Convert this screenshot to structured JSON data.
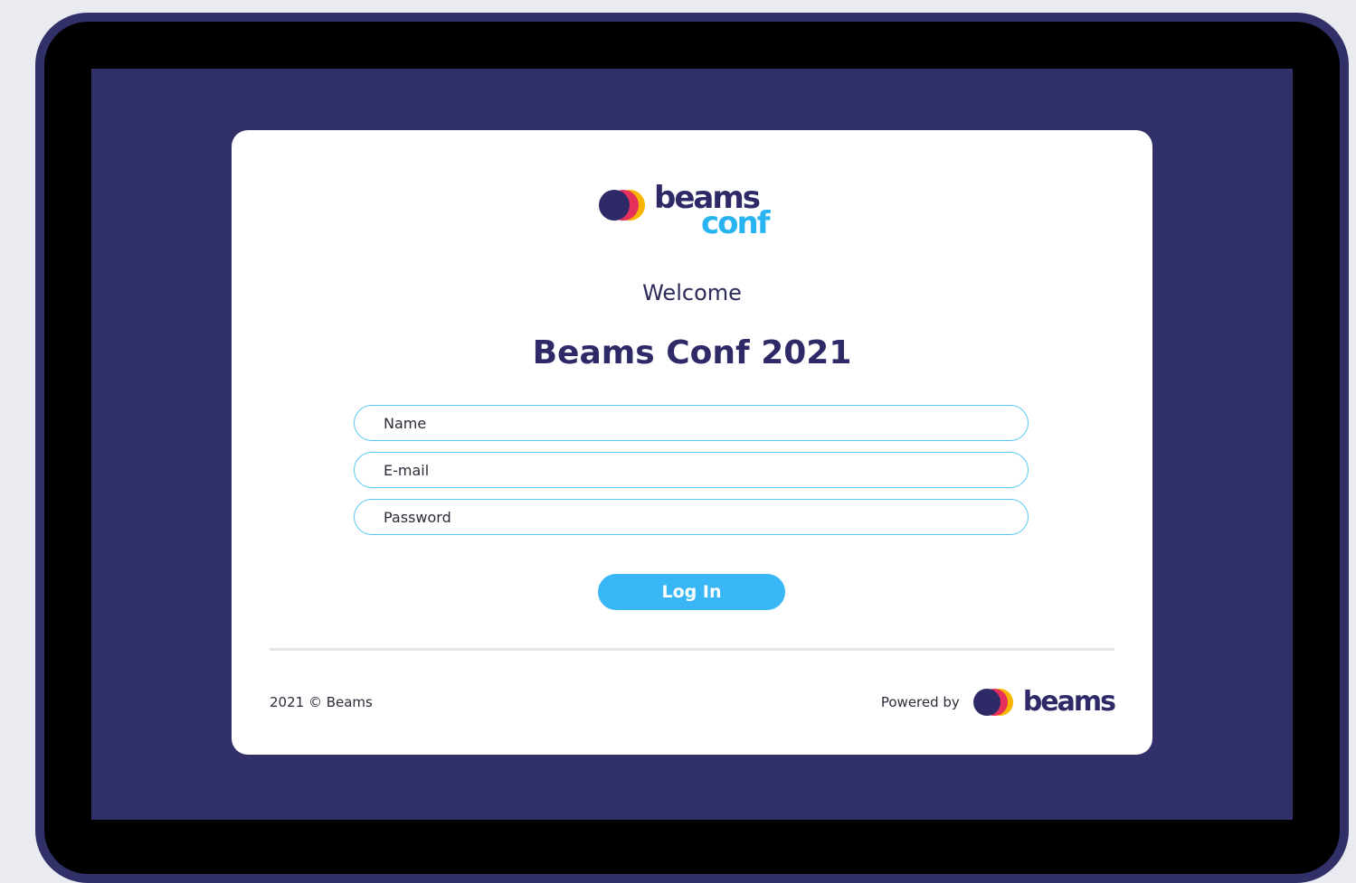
{
  "logo": {
    "word_top": "beams",
    "word_bottom": "conf",
    "icon": "beams-logo-icon"
  },
  "heading": {
    "welcome": "Welcome",
    "title": "Beams Conf 2021"
  },
  "form": {
    "name_placeholder": "Name",
    "email_placeholder": "E-mail",
    "password_placeholder": "Password",
    "submit_label": "Log In"
  },
  "footer": {
    "copyright": "2021 © Beams",
    "powered_label": "Powered by",
    "powered_brand": "beams"
  },
  "colors": {
    "page_bg": "#e9ebf1",
    "frame": "#313068",
    "screen_bg": "#313068",
    "brand_navy": "#2d2a67",
    "accent_blue": "#38b6f5",
    "logo_red": "#e6305c",
    "logo_yellow": "#f7b500"
  }
}
